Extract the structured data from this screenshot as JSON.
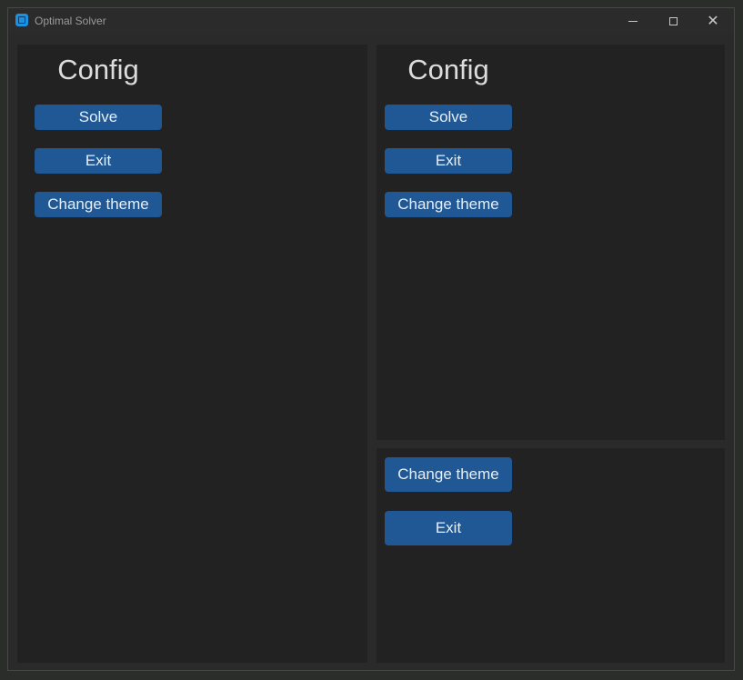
{
  "window": {
    "title": "Optimal Solver",
    "minimize_icon": "minimize-icon",
    "maximize_icon": "maximize-icon",
    "close_icon": "close-icon",
    "close_glyph": "✕"
  },
  "left_panel": {
    "title": "Config",
    "buttons": [
      "Solve",
      "Exit",
      "Change theme"
    ]
  },
  "right_top_panel": {
    "title": "Config",
    "buttons": [
      "Solve",
      "Exit",
      "Change theme"
    ]
  },
  "right_bottom_panel": {
    "buttons": [
      "Change theme",
      "Exit"
    ]
  },
  "colors": {
    "accent": "#1f5894",
    "background": "#222222",
    "frame": "#2a2a2a",
    "app_icon": "#1e90e0"
  }
}
